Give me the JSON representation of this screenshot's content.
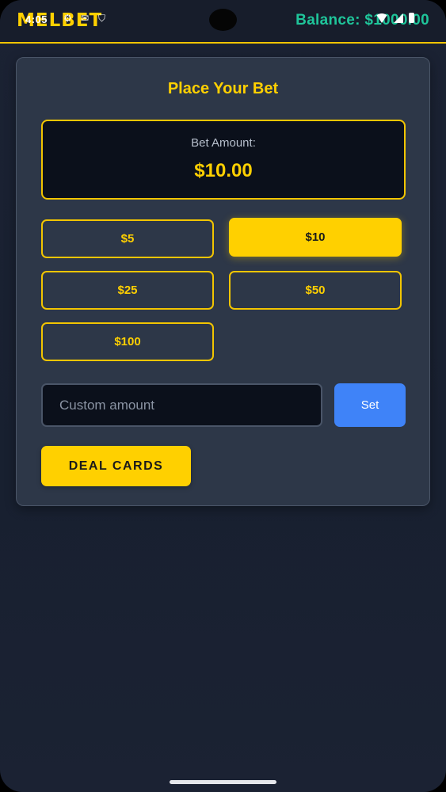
{
  "header": {
    "logo": "MELBET",
    "balance": "Balance: $1000.00"
  },
  "status_bar": {
    "time": "4:05",
    "icons": [
      "gear-icon",
      "mail-icon",
      "shield-icon",
      "wifi-icon",
      "signal-icon",
      "battery-icon"
    ]
  },
  "bet_panel": {
    "title": "Place Your Bet",
    "amount_label": "Bet Amount:",
    "amount_value": "$10.00",
    "chips": [
      "$5",
      "$10",
      "$25",
      "$50",
      "$100"
    ],
    "selected_chip": "$10",
    "custom_placeholder": "Custom amount",
    "custom_value": "",
    "set_label": "Set",
    "deal_label": "DEAL CARDS"
  },
  "colors": {
    "accent": "#ffd000",
    "balance": "#1fc59a",
    "panel": "#2d3748",
    "background": "#1b2233",
    "set_button": "#3f83f8"
  }
}
